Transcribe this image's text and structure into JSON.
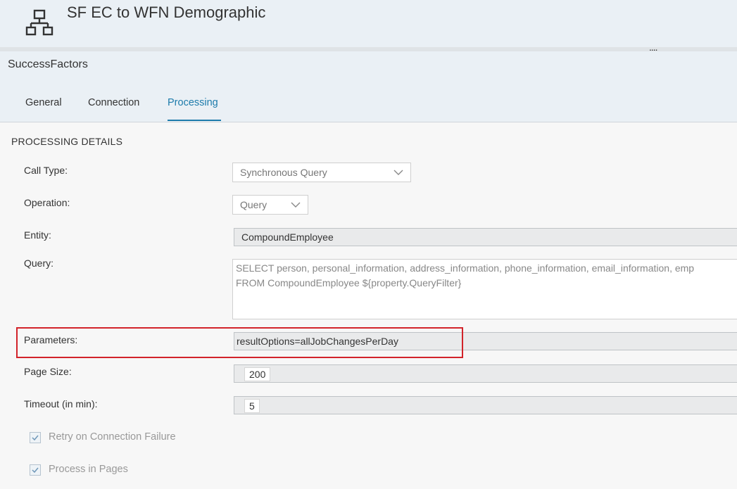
{
  "header": {
    "title": "SF EC to WFN Demographic",
    "more_label": "...."
  },
  "subheader": {
    "system_name": "SuccessFactors"
  },
  "tabs": [
    {
      "label": "General"
    },
    {
      "label": "Connection"
    },
    {
      "label": "Processing",
      "active": true
    }
  ],
  "section": {
    "title": "PROCESSING DETAILS"
  },
  "form": {
    "call_type": {
      "label": "Call Type:",
      "value": "Synchronous Query"
    },
    "operation": {
      "label": "Operation:",
      "value": "Query"
    },
    "entity": {
      "label": "Entity:",
      "value": "CompoundEmployee"
    },
    "query": {
      "label": "Query:",
      "line1": "SELECT person, personal_information, address_information, phone_information, email_information, emp",
      "line2": "FROM CompoundEmployee ${property.QueryFilter}"
    },
    "parameters": {
      "label": "Parameters:",
      "value": "resultOptions=allJobChangesPerDay"
    },
    "page_size": {
      "label": "Page Size:",
      "value": "200"
    },
    "timeout": {
      "label": "Timeout (in min):",
      "value": "5"
    },
    "retry": {
      "label": "Retry on Connection Failure",
      "checked": true
    },
    "process_in_pages": {
      "label": "Process in Pages",
      "checked": true
    }
  },
  "colors": {
    "accent": "#1d7bab",
    "highlight_border": "#d2232a",
    "header_bg": "#eaf0f5"
  },
  "icons": {
    "app": "hierarchy-icon",
    "dropdown": "chevron-down-icon",
    "check": "checkmark-icon"
  }
}
